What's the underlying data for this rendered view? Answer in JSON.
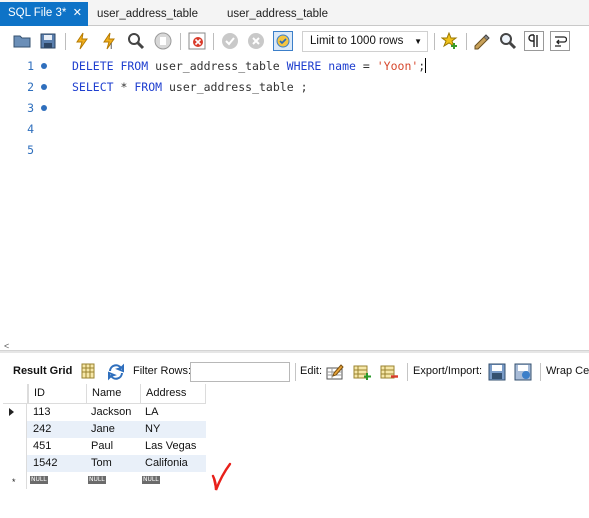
{
  "tabs": [
    {
      "label": "SQL File 3*",
      "active": true,
      "close": "✕"
    },
    {
      "label": "user_address_table",
      "active": false
    },
    {
      "label": "user_address_table",
      "active": false
    }
  ],
  "toolbar": {
    "limit_label": "Limit to 1000 rows",
    "limit_arrow": "▼"
  },
  "editor": {
    "lines": [
      {
        "num": "1",
        "has_dot": true
      },
      {
        "num": "2",
        "has_dot": true
      },
      {
        "num": "3",
        "has_dot": true
      },
      {
        "num": "4",
        "has_dot": false
      },
      {
        "num": "5",
        "has_dot": false
      }
    ],
    "line1": {
      "kw1": "DELETE FROM",
      "table": "user_address_table",
      "kw2": "WHERE",
      "col": "name",
      "op": "=",
      "str": "'Yoon'",
      "end": ";"
    },
    "line2": {
      "kw1": "SELECT",
      "star": "*",
      "kw2": "FROM",
      "table": "user_address_table",
      "end": ";"
    }
  },
  "result_toolbar": {
    "result_grid": "Result Grid",
    "filter_rows": "Filter Rows:",
    "edit": "Edit:",
    "export_import": "Export/Import:",
    "wrap": "Wrap Cel"
  },
  "grid": {
    "columns": [
      "ID",
      "Name",
      "Address"
    ],
    "rows": [
      [
        "113",
        "Jackson",
        "LA"
      ],
      [
        "242",
        "Jane",
        "NY"
      ],
      [
        "451",
        "Paul",
        "Las Vegas"
      ],
      [
        "1542",
        "Tom",
        "Califonia"
      ]
    ],
    "null_label": "NULL",
    "new_row_marker": "*"
  },
  "colors": {
    "tab_active": "#0e73c7",
    "keyword": "#1f3fcf",
    "string": "#d6472c",
    "line_number": "#2f6fbd",
    "alt_row": "#e9f0f9",
    "annotation": "#e8201a"
  }
}
